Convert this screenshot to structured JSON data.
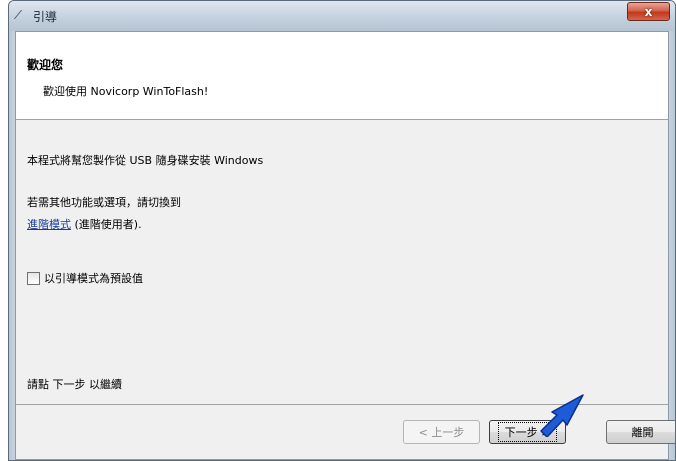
{
  "window": {
    "title": "引導",
    "app_icon": "wand-icon",
    "close_label": "x"
  },
  "header": {
    "title": "歡迎您",
    "subtitle": "歡迎使用 Novicorp WinToFlash!"
  },
  "body": {
    "line1": "本程式將幫您製作從 USB 隨身碟安裝 Windows",
    "line2": "若需其他功能或選項，請切換到",
    "link_text": "進階模式",
    "link_suffix": " (進階使用者).",
    "checkbox_label": "以引導模式為預設值",
    "checkbox_checked": false,
    "footer_hint": "請點 下一步 以繼續"
  },
  "buttons": {
    "back": "< 上一步",
    "next": "下一步 >",
    "exit": "離開"
  },
  "colors": {
    "link": "#1a3a9a",
    "pointer": "#1f5bd8",
    "close": "#c0391f"
  }
}
